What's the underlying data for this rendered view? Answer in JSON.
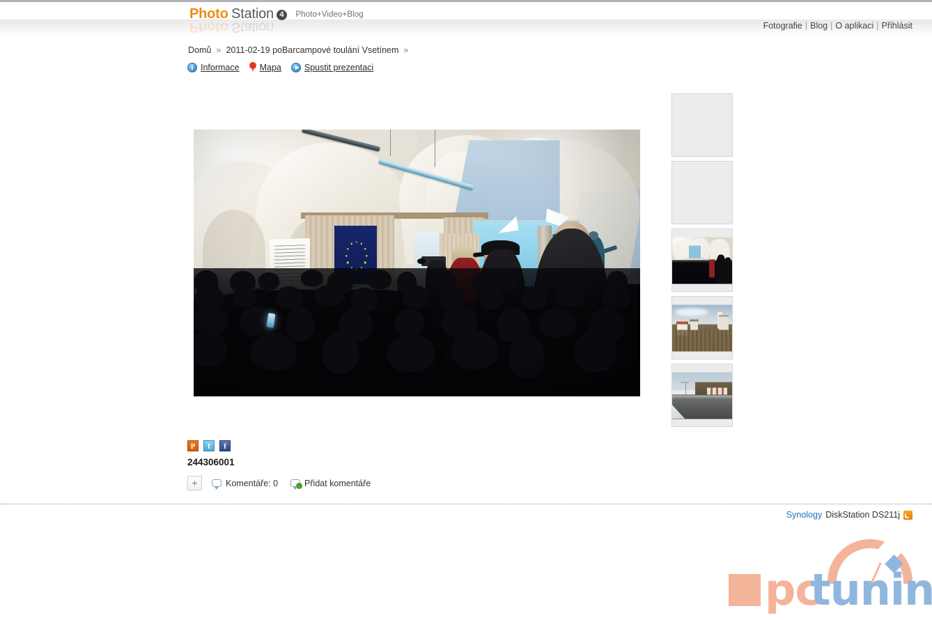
{
  "header": {
    "brand_primary": "Photo",
    "brand_secondary": "Station",
    "brand_version": "4",
    "brand_tagline": "Photo+Video+Blog",
    "brand_color": "#f08a16",
    "nav": [
      {
        "label": "Fotografie"
      },
      {
        "label": "Blog"
      },
      {
        "label": "O aplikaci"
      },
      {
        "label": "Přihlásit"
      }
    ],
    "nav_separator": "|"
  },
  "breadcrumb": {
    "chevron": "»",
    "items": [
      {
        "label": "Domů"
      },
      {
        "label": "2011-02-19 poBarcampové toulání Vsetínem"
      }
    ],
    "trailing_chevron": "»"
  },
  "actionbar": {
    "items": [
      {
        "icon": "info-icon",
        "glyph": "i",
        "label": "Informace"
      },
      {
        "icon": "map-pin-icon",
        "glyph": "",
        "label": "Mapa"
      },
      {
        "icon": "play-icon",
        "glyph": "",
        "label": "Spustit prezentaci"
      }
    ]
  },
  "viewer": {
    "photo_alt": "Conference hall with vaulted white ceiling, EU flag, projection screen and seated audience",
    "caption": "244306001"
  },
  "thumbnails": [
    {
      "index": 1,
      "state": "loading",
      "selected": false,
      "alt": ""
    },
    {
      "index": 2,
      "state": "loading",
      "selected": false,
      "alt": ""
    },
    {
      "index": 3,
      "state": "loaded",
      "selected": true,
      "alt": "Conference hall audience"
    },
    {
      "index": 4,
      "state": "loaded",
      "selected": false,
      "alt": "Town with church tower on hillside"
    },
    {
      "index": 5,
      "state": "loaded",
      "selected": false,
      "alt": "Bridge over river with snowy bank"
    }
  ],
  "social": [
    {
      "name": "plurk",
      "glyph": "P",
      "color": "#e06b10"
    },
    {
      "name": "twitter",
      "glyph": "t",
      "color": "#5fb4dd"
    },
    {
      "name": "facebook",
      "glyph": "f",
      "color": "#3b5998"
    }
  ],
  "comments": {
    "add_button_glyph": "+",
    "count_label": "Komentáře: 0",
    "add_label": "Přidat komentáře"
  },
  "footer": {
    "brand": "Synology",
    "device": "DiskStation DS211j",
    "brand_color": "#1f72c4",
    "rss_icon": "rss-icon"
  },
  "watermark": {
    "text_primary": "pc",
    "text_secondary": "tuning",
    "color_primary": "#f4b49a",
    "color_secondary": "#8fb6dd"
  }
}
